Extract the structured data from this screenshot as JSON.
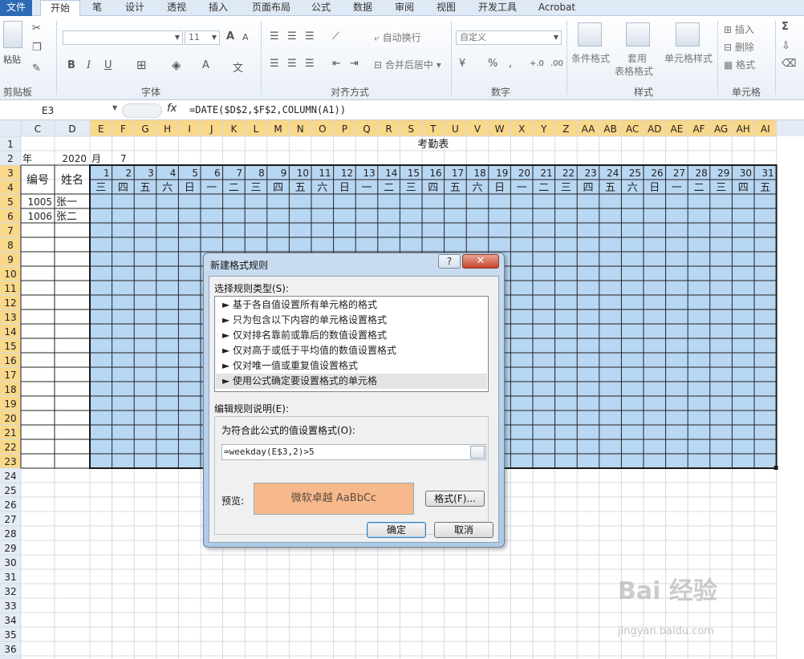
{
  "tabs": [
    "文件",
    "开始",
    "笔",
    "设计",
    "透视",
    "插入",
    "页面布局",
    "公式",
    "数据",
    "审阅",
    "视图",
    "开发工具",
    "Acrobat"
  ],
  "ribbon": {
    "clipboard": {
      "paste": "粘贴",
      "group": "剪贴板"
    },
    "font": {
      "size": "11",
      "group": "字体",
      "bold": "B",
      "italic": "I",
      "underline": "U",
      "grow": "A",
      "shrink": "A",
      "color": "A",
      "phonetic": "文"
    },
    "align": {
      "wrap": "自动换行",
      "merge": "合并后居中",
      "group": "对齐方式"
    },
    "number": {
      "format": "自定义",
      "percent": "%",
      "comma": ",",
      "inc": "+.0",
      "dec": ".00",
      "group": "数字"
    },
    "styles": {
      "cond": "条件格式",
      "table1": "套用",
      "table2": "表格格式",
      "cell": "单元格样式",
      "group": "样式"
    },
    "cells": {
      "insert": "插入",
      "delete": "删除",
      "format": "格式",
      "group": "单元格"
    },
    "edit": {
      "sum": "Σ"
    }
  },
  "formula_bar": {
    "name": "E3",
    "fx": "fx",
    "formula": "=DATE($D$2,$F$2,COLUMN(A1))"
  },
  "sheet": {
    "columns": [
      "C",
      "D",
      "E",
      "F",
      "G",
      "H",
      "I",
      "J",
      "K",
      "L",
      "M",
      "N",
      "O",
      "P",
      "Q",
      "R",
      "S",
      "T",
      "U",
      "V",
      "W",
      "X",
      "Y",
      "Z",
      "AA",
      "AB",
      "AC",
      "AD",
      "AE",
      "AF",
      "AG",
      "AH",
      "AI"
    ],
    "rows": [
      "1",
      "2",
      "3",
      "4",
      "5",
      "6",
      "7",
      "8",
      "9",
      "10",
      "11",
      "12",
      "13",
      "14",
      "15",
      "16",
      "17",
      "18",
      "19",
      "20",
      "21",
      "22",
      "23",
      "24",
      "25",
      "26",
      "27",
      "28",
      "29",
      "30",
      "31",
      "32",
      "33",
      "34",
      "35",
      "36"
    ],
    "title": "考勤表",
    "row2": {
      "year_label": "年",
      "year": "2020",
      "month_label": "月",
      "month": "7"
    },
    "header_id": "编号",
    "header_name": "姓名",
    "days": [
      "1",
      "2",
      "3",
      "4",
      "5",
      "6",
      "7",
      "8",
      "9",
      "10",
      "11",
      "12",
      "13",
      "14",
      "15",
      "16",
      "17",
      "18",
      "19",
      "20",
      "21",
      "22",
      "23",
      "24",
      "25",
      "26",
      "27",
      "28",
      "29",
      "30",
      "31"
    ],
    "weekdays": [
      "三",
      "四",
      "五",
      "六",
      "日",
      "一",
      "二",
      "三",
      "四",
      "五",
      "六",
      "日",
      "一",
      "二",
      "三",
      "四",
      "五",
      "六",
      "日",
      "一",
      "二",
      "三",
      "四",
      "五",
      "六",
      "日",
      "一",
      "二",
      "三",
      "四",
      "五"
    ],
    "people": [
      {
        "id": "1005",
        "name": "张一"
      },
      {
        "id": "1006",
        "name": "张二"
      }
    ]
  },
  "dialog": {
    "title": "新建格式规则",
    "help": "?",
    "close": "✕",
    "select_label": "选择规则类型(S):",
    "rules": [
      "► 基于各自值设置所有单元格的格式",
      "► 只为包含以下内容的单元格设置格式",
      "► 仅对排名靠前或靠后的数值设置格式",
      "► 仅对高于或低于平均值的数值设置格式",
      "► 仅对唯一值或重复值设置格式",
      "► 使用公式确定要设置格式的单元格"
    ],
    "edit_label": "编辑规则说明(E):",
    "formula_label": "为符合此公式的值设置格式(O):",
    "formula_value": "=weekday(E$3,2)>5",
    "preview_label": "预览:",
    "preview_text": "微软卓越  AaBbCc",
    "format_button": "格式(F)...",
    "ok": "确定",
    "cancel": "取消"
  },
  "watermark": {
    "brand": "Bai 经验",
    "url": "jingyan.baidu.com"
  }
}
